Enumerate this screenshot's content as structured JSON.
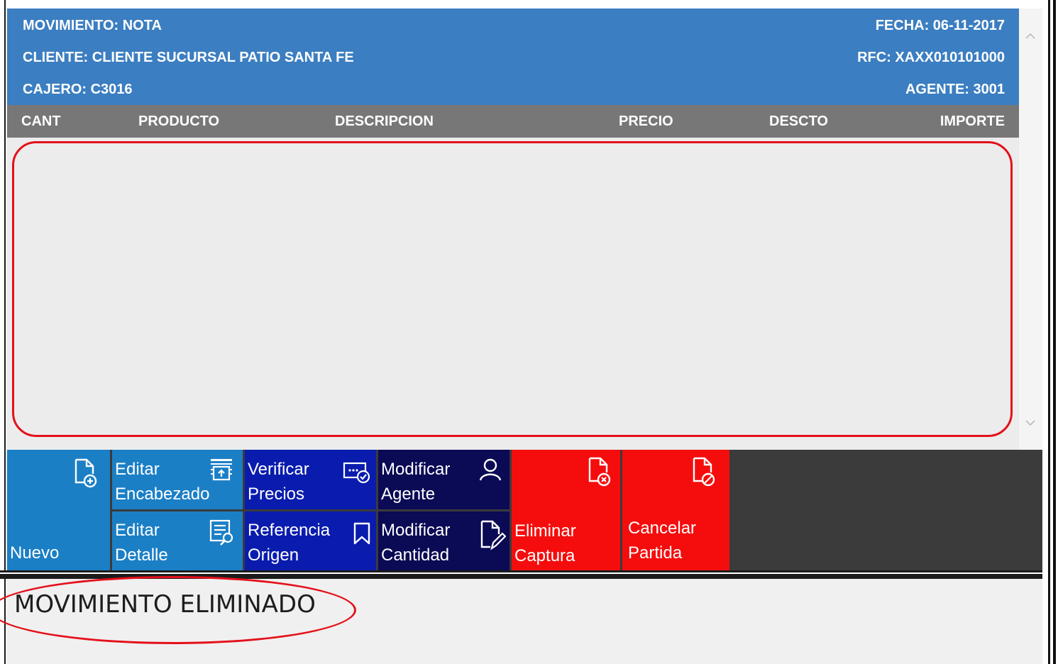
{
  "header": {
    "movimiento": "MOVIMIENTO: NOTA",
    "fecha": "FECHA: 06-11-2017",
    "cliente": "CLIENTE: CLIENTE SUCURSAL PATIO SANTA FE",
    "rfc": "RFC: XAXX010101000",
    "cajero": "CAJERO: C3016",
    "agente": "AGENTE: 3001"
  },
  "columns": {
    "cant": "CANT",
    "producto": "PRODUCTO",
    "descripcion": "DESCRIPCION",
    "precio": "PRECIO",
    "descto": "DESCTO",
    "importe": "IMPORTE"
  },
  "rows": [],
  "toolbar": {
    "nuevo": {
      "label": "Nuevo",
      "icon": "document-add-icon"
    },
    "editar_encabezado": {
      "line1": "Editar",
      "line2": "Encabezado",
      "icon": "header-edit-icon"
    },
    "editar_detalle": {
      "line1": "Editar",
      "line2": "Detalle",
      "icon": "list-search-icon"
    },
    "verificar_precios": {
      "line1": "Verificar",
      "line2": "Precios",
      "icon": "price-check-icon"
    },
    "referencia_origen": {
      "line1": "Referencia",
      "line2": "Origen",
      "icon": "bookmark-icon"
    },
    "modificar_agente": {
      "line1": "Modificar",
      "line2": "Agente",
      "icon": "person-icon"
    },
    "modificar_cantidad": {
      "line1": "Modificar",
      "line2": "Cantidad",
      "icon": "document-edit-icon"
    },
    "eliminar_captura": {
      "line1": "Eliminar",
      "line2": "Captura",
      "icon": "document-delete-icon"
    },
    "cancelar_partida": {
      "line1": "Cancelar",
      "line2": "Partida",
      "icon": "document-block-icon"
    }
  },
  "status": {
    "message": "MOVIMIENTO ELIMINADO"
  },
  "colors": {
    "header": "#3b7ec1",
    "column_bar": "#777777",
    "light_blue": "#1b7fc6",
    "blue": "#0a1cae",
    "navy": "#0a0a55",
    "red": "#f50d0d",
    "annotation": "#e4101a"
  }
}
